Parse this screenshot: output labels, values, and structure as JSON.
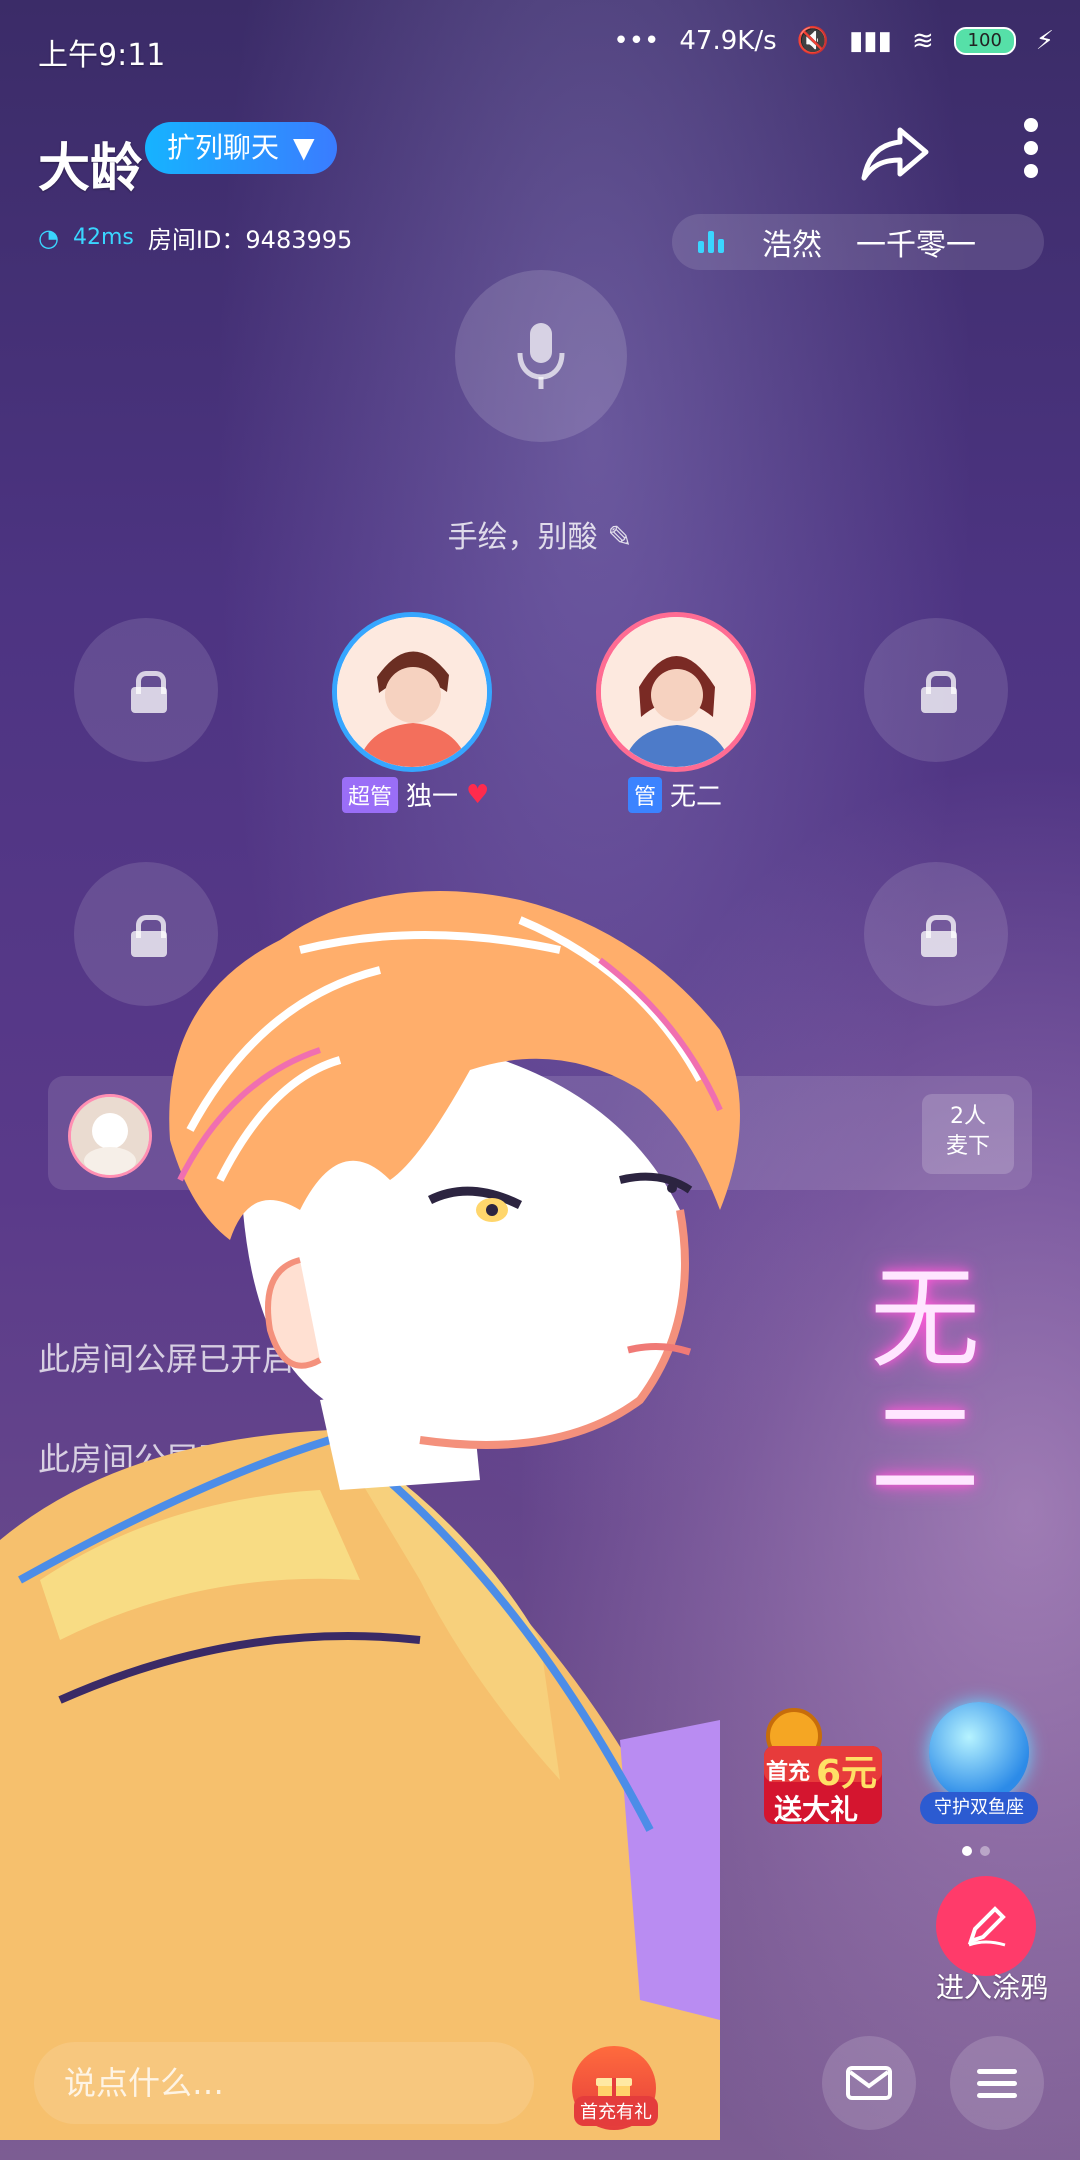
{
  "status_bar": {
    "time": "上午9:11",
    "net_speed": "47.9K/s",
    "battery": "100"
  },
  "header": {
    "room_title": "大龄",
    "expand_chip": "扩列聊天",
    "ping": "42ms",
    "room_id": "房间ID：9483995",
    "music_left": "浩然",
    "music_right": "一千零一"
  },
  "mic": {
    "note": "手绘，别酸"
  },
  "seats": {
    "host1": {
      "role": "超管",
      "name": "独一"
    },
    "host2": {
      "role": "管",
      "name": "无二"
    }
  },
  "audience": {
    "down_mic_count": "2人",
    "down_mic_label": "麦下"
  },
  "notices": [
    "此房间公屏已开启",
    "此房间公屏已开启"
  ],
  "neon_text": "无二",
  "promos": {
    "first_charge_top": "首充",
    "first_charge_amount": "6元",
    "first_charge_bottom": "送大礼",
    "zodiac_label": "守护双鱼座"
  },
  "graffiti_label": "进入涂鸦",
  "bottom_bar": {
    "chat_placeholder": "说点什么…",
    "gift_label": "首充有礼"
  },
  "colors": {
    "accent_blue": "#36a6ff",
    "accent_pink": "#ff6c93",
    "graffiti_red": "#ff3b6a"
  }
}
